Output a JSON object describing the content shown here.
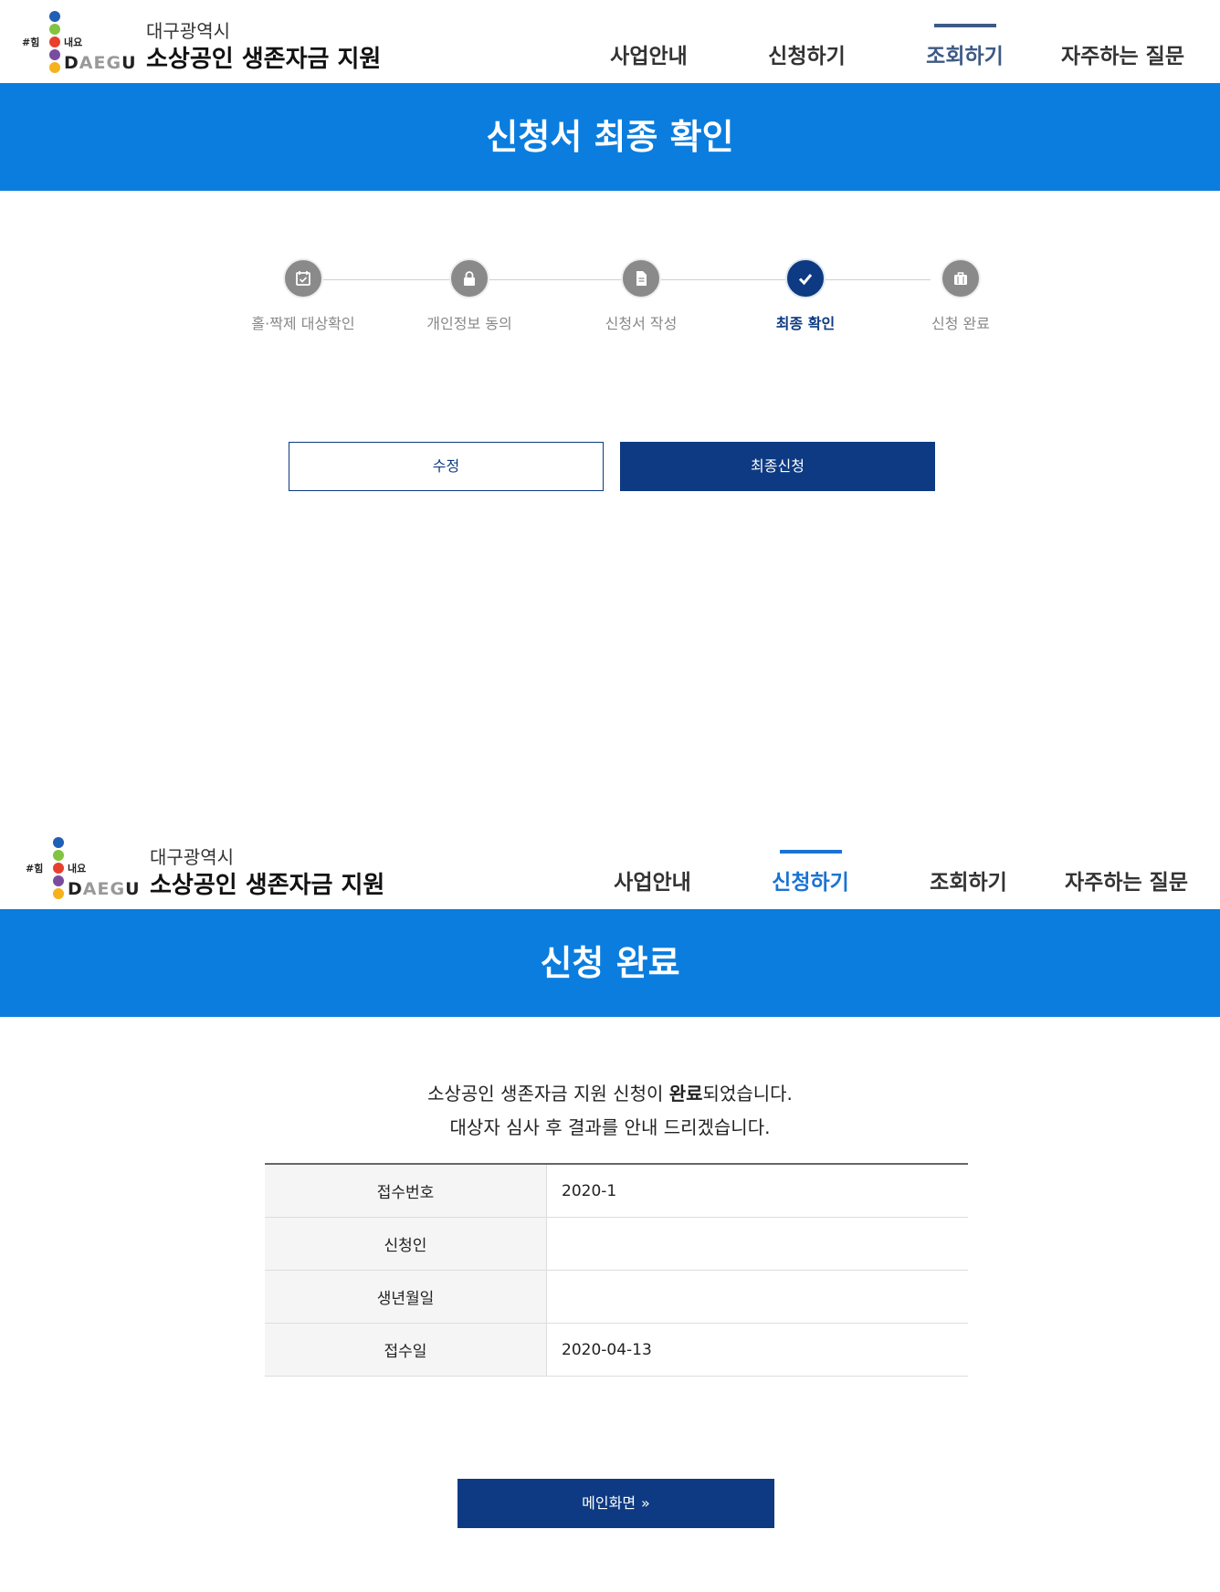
{
  "screen1": {
    "header": {
      "logo": {
        "hash": "#힘",
        "naeyo": "내요",
        "daegu_d": "D",
        "daegu_ae": "AEG",
        "daegu_u": "U"
      },
      "title_small": "대구광역시",
      "title_big": "소상공인 생존자금 지원",
      "nav": [
        "사업안내",
        "신청하기",
        "조회하기",
        "자주하는 질문"
      ],
      "active_nav": "조회하기"
    },
    "banner": "신청서 최종 확인",
    "steps": [
      {
        "label": "홀·짝제 대상확인",
        "icon": "calendar-icon"
      },
      {
        "label": "개인정보 동의",
        "icon": "lock-icon"
      },
      {
        "label": "신청서 작성",
        "icon": "document-icon"
      },
      {
        "label": "최종 확인",
        "icon": "check-icon",
        "current": true
      },
      {
        "label": "신청 완료",
        "icon": "briefcase-icon"
      }
    ],
    "buttons": {
      "edit": "수정",
      "submit": "최종신청"
    }
  },
  "screen2": {
    "header": {
      "logo": {
        "hash": "#힘",
        "naeyo": "내요",
        "daegu_d": "D",
        "daegu_ae": "AEG",
        "daegu_u": "U"
      },
      "title_small": "대구광역시",
      "title_big": "소상공인 생존자금 지원",
      "nav": [
        "사업안내",
        "신청하기",
        "조회하기",
        "자주하는 질문"
      ],
      "active_nav": "신청하기"
    },
    "banner": "신청 완료",
    "message": {
      "line1_pre": "소상공인 생존자금 지원 신청이 ",
      "line1_bold": "완료",
      "line1_post": "되었습니다.",
      "line2": "대상자 심사 후 결과를 안내 드리겠습니다."
    },
    "table": [
      {
        "key": "접수번호",
        "value": "2020-1"
      },
      {
        "key": "신청인",
        "value": ""
      },
      {
        "key": "생년월일",
        "value": ""
      },
      {
        "key": "접수일",
        "value": "2020-04-13"
      }
    ],
    "main_button": "메인화면",
    "main_button_arrow": "»"
  },
  "colors": {
    "banner_blue": "#0a7ddf",
    "navy": "#0d3a82",
    "nav_active_1": "#3d5a86",
    "nav_active_2": "#1a73d4"
  }
}
